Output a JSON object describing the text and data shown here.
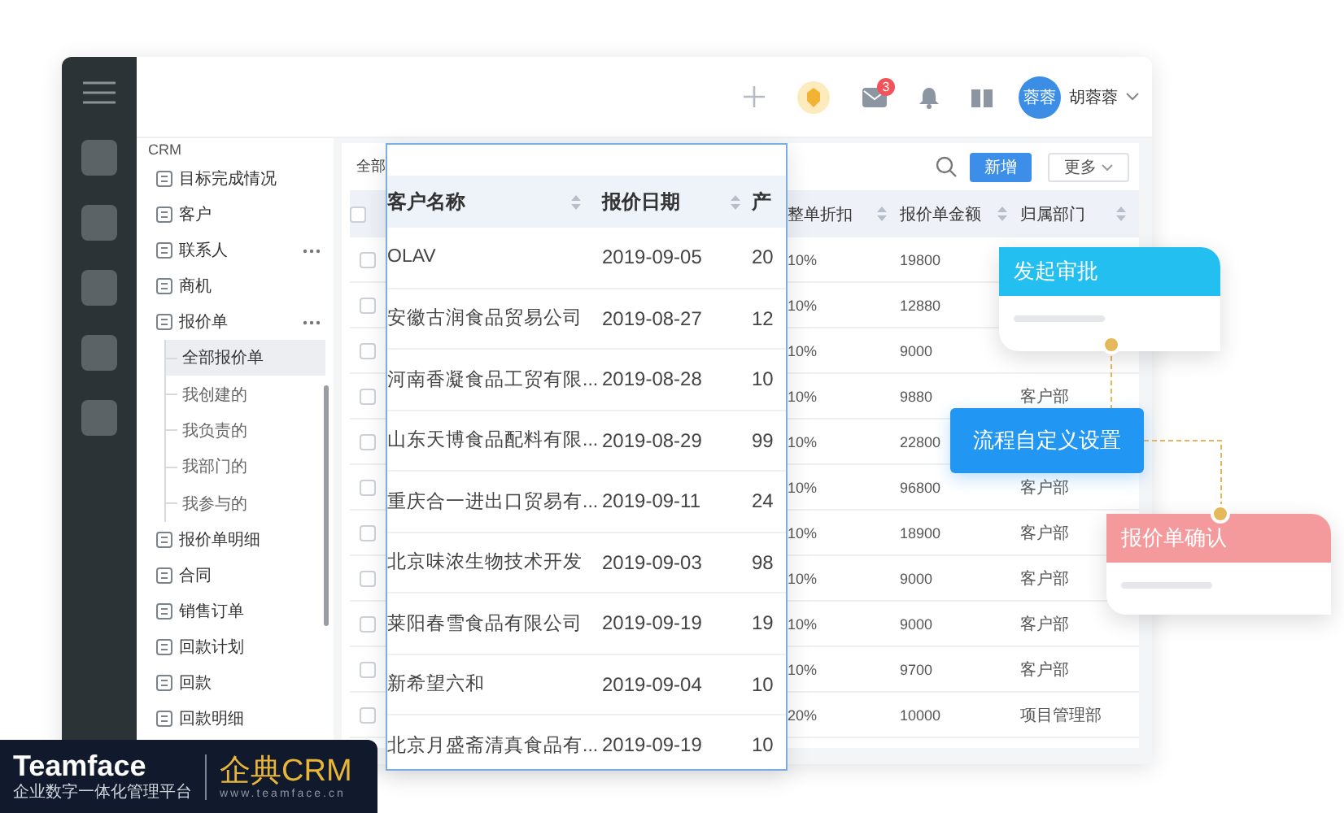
{
  "header": {
    "avatar": "蓉蓉",
    "user_name": "胡蓉蓉",
    "mail_badge": "3"
  },
  "sidebar": {
    "title": "CRM",
    "items": [
      {
        "label": "目标完成情况",
        "selected": false,
        "more": false
      },
      {
        "label": "客户",
        "selected": false,
        "more": false
      },
      {
        "label": "联系人",
        "selected": false,
        "more": true
      },
      {
        "label": "商机",
        "selected": false,
        "more": false
      },
      {
        "label": "报价单",
        "selected": false,
        "more": true,
        "expanded": true,
        "children": [
          {
            "label": "全部报价单",
            "selected": true
          },
          {
            "label": "我创建的",
            "selected": false
          },
          {
            "label": "我负责的",
            "selected": false
          },
          {
            "label": "我部门的",
            "selected": false
          },
          {
            "label": "我参与的",
            "selected": false
          }
        ]
      },
      {
        "label": "报价单明细",
        "selected": false,
        "more": false
      },
      {
        "label": "合同",
        "selected": false,
        "more": false
      },
      {
        "label": "销售订单",
        "selected": false,
        "more": false
      },
      {
        "label": "回款计划",
        "selected": false,
        "more": false
      },
      {
        "label": "回款",
        "selected": false,
        "more": false
      },
      {
        "label": "回款明细",
        "selected": false,
        "more": false
      }
    ]
  },
  "toolbar": {
    "filter": "全部",
    "new_button": "新增",
    "more_button": "更多"
  },
  "table": {
    "select_all": false,
    "columns": [
      "整单折扣",
      "报价单金额",
      "归属部门"
    ],
    "rows": [
      {
        "checked": false,
        "discount": "10%",
        "amount": "19800"
      },
      {
        "checked": false,
        "discount": "10%",
        "amount": "12880"
      },
      {
        "checked": false,
        "discount": "10%",
        "amount": "9000"
      },
      {
        "checked": false,
        "discount": "10%",
        "amount": "9880",
        "department": "客户部"
      },
      {
        "checked": false,
        "discount": "10%",
        "amount": "22800"
      },
      {
        "checked": false,
        "discount": "10%",
        "amount": "96800",
        "department": "客户部"
      },
      {
        "checked": false,
        "discount": "10%",
        "amount": "18900",
        "department": "客户部"
      },
      {
        "checked": false,
        "discount": "10%",
        "amount": "9000",
        "department": "客户部"
      },
      {
        "checked": false,
        "discount": "10%",
        "amount": "9000",
        "department": "客户部"
      },
      {
        "checked": false,
        "discount": "10%",
        "amount": "9700",
        "department": "客户部"
      },
      {
        "checked": false,
        "discount": "20%",
        "amount": "10000",
        "department": "项目管理部"
      }
    ]
  },
  "zoom_panel": {
    "columns": [
      "客户名称",
      "报价日期",
      "产"
    ],
    "rows": [
      {
        "customer": "OLAV",
        "date": "2019-09-05",
        "product": "20"
      },
      {
        "customer": "安徽古润食品贸易公司",
        "date": "2019-08-27",
        "product": "12"
      },
      {
        "customer": "河南香凝食品工贸有限...",
        "date": "2019-08-28",
        "product": "10"
      },
      {
        "customer": "山东天博食品配料有限...",
        "date": "2019-08-29",
        "product": "99"
      },
      {
        "customer": "重庆合一进出口贸易有...",
        "date": "2019-09-11",
        "product": "24"
      },
      {
        "customer": "北京味浓生物技术开发",
        "date": "2019-09-03",
        "product": "98"
      },
      {
        "customer": "莱阳春雪食品有限公司",
        "date": "2019-09-19",
        "product": "19"
      },
      {
        "customer": "新希望六和",
        "date": "2019-09-04",
        "product": "10"
      },
      {
        "customer": "北京月盛斋清真食品有...",
        "date": "2019-09-19",
        "product": "10"
      }
    ]
  },
  "flow": {
    "steps": [
      {
        "label": "发起审批",
        "kind": "card",
        "color": "#22bff0"
      },
      {
        "label": "流程自定义设置",
        "kind": "button",
        "color": "#2196f3"
      },
      {
        "label": "报价单确认",
        "kind": "card",
        "color": "#f59a9c"
      }
    ]
  },
  "brand": {
    "name": "Teamface",
    "tagline": "企业数字一体化管理平台",
    "product": "企典CRM",
    "url": "www.teamface.cn"
  }
}
